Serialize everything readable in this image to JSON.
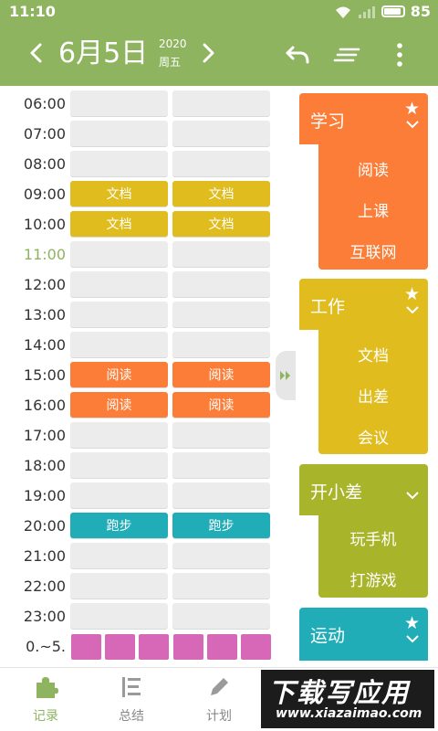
{
  "status_bar": {
    "time": "11:10",
    "battery": "85"
  },
  "header": {
    "date": "6月5日",
    "year": "2020",
    "weekday": "周五"
  },
  "timeline": {
    "current_hour": "11:00",
    "hours": [
      "06:00",
      "07:00",
      "08:00",
      "09:00",
      "10:00",
      "11:00",
      "12:00",
      "13:00",
      "14:00",
      "15:00",
      "16:00",
      "17:00",
      "18:00",
      "19:00",
      "20:00",
      "21:00",
      "22:00",
      "23:00",
      "0.~5."
    ],
    "blocks": [
      "",
      "",
      "",
      "文档",
      "文档",
      "",
      "",
      "",
      "",
      "阅读",
      "阅读",
      "",
      "",
      "",
      "跑步",
      "",
      "",
      "",
      ""
    ]
  },
  "categories": [
    {
      "title": "学习",
      "starred": true,
      "items": [
        "阅读",
        "上课",
        "互联网"
      ]
    },
    {
      "title": "工作",
      "starred": true,
      "items": [
        "文档",
        "出差",
        "会议"
      ]
    },
    {
      "title": "开小差",
      "starred": false,
      "items": [
        "玩手机",
        "打游戏"
      ]
    },
    {
      "title": "运动",
      "starred": true,
      "items": []
    }
  ],
  "bottom_nav": [
    {
      "label": "记录",
      "active": true
    },
    {
      "label": "总结",
      "active": false
    },
    {
      "label": "计划",
      "active": false
    }
  ],
  "watermark": {
    "main": "下载写应用",
    "url": "www.xiazaimao.com"
  },
  "colors": {
    "primary": "#8fb45f",
    "empty": "#ececec",
    "doc": "#e0bc1e",
    "reading": "#fb7d37",
    "running": "#20adb7",
    "night": "#d767b7",
    "study": "#fb7d37",
    "work": "#e0bc1e",
    "slack": "#a8b42a",
    "sport": "#20adb7"
  }
}
